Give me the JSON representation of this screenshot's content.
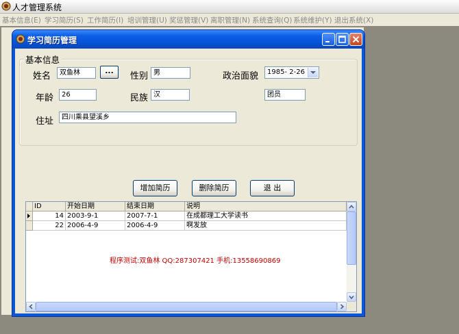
{
  "app": {
    "title": "人才管理系统"
  },
  "menu": [
    "基本信息(E)",
    "学习简历(S)",
    "工作简历(I)",
    "培训管理(U)",
    "奖惩管理(V)",
    "离职管理(N)",
    "系统查询(Q)",
    "系统维护(Y)",
    "退出系统(X)"
  ],
  "window": {
    "title": "学习简历管理"
  },
  "basic_info": {
    "legend": "基本信息",
    "name_label": "姓名",
    "name_value": "双鱼林",
    "browse_label": "...",
    "gender_label": "性别",
    "gender_value": "男",
    "politics_label": "政治面貌",
    "date_value": "1985- 2-26",
    "politics_value": "团员",
    "age_label": "年龄",
    "age_value": "26",
    "ethnicity_label": "民族",
    "ethnicity_value": "汉",
    "address_label": "住址",
    "address_value": "四川乘县望溪乡"
  },
  "buttons": {
    "add": "增加简历",
    "delete": "删除简历",
    "exit": "退 出"
  },
  "grid": {
    "columns": [
      "ID",
      "开始日期",
      "结束日期",
      "说明"
    ],
    "rows": [
      {
        "id": "14",
        "start": "2003-9-1",
        "end": "2007-7-1",
        "desc": "在成都理工大学读书"
      },
      {
        "id": "22",
        "start": "2006-4-9",
        "end": "2006-4-9",
        "desc": "啊发放"
      }
    ],
    "note": "程序测试:双鱼林 QQ:287307421 手机:13558690869"
  },
  "colors": {
    "titlebar": "#0552d5",
    "face": "#ece9d8",
    "note": "#c00000",
    "desktop": "#8c8a7f"
  }
}
